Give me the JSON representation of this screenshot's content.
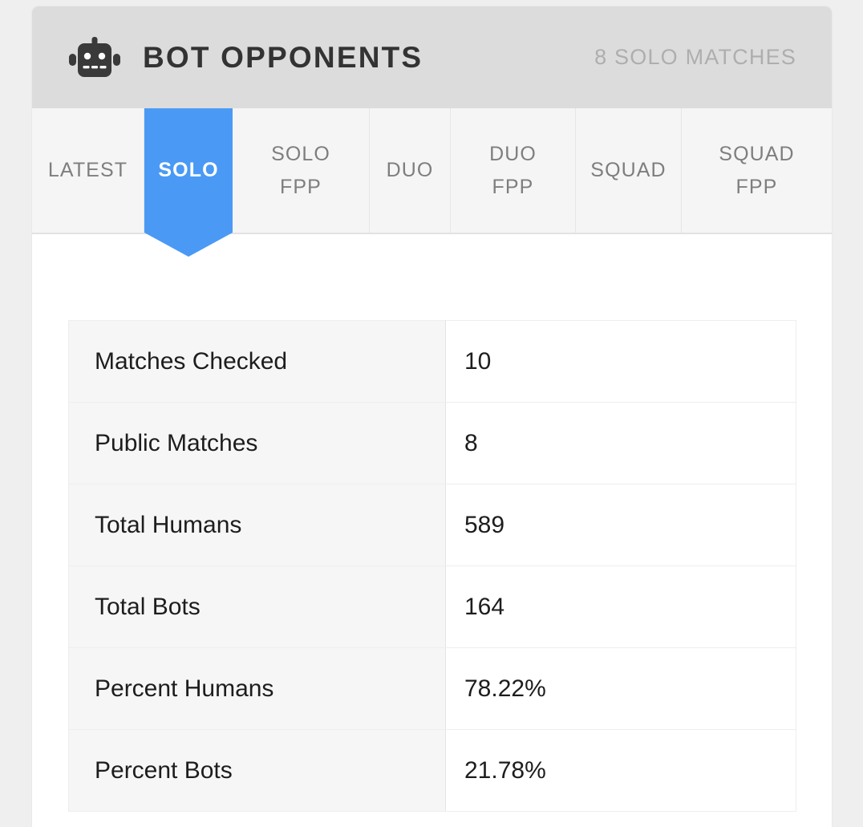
{
  "header": {
    "icon": "robot-icon",
    "title": "BOT OPPONENTS",
    "subtitle": "8 SOLO MATCHES"
  },
  "tabs": [
    {
      "label": "LATEST",
      "line1": "LATEST",
      "line2": "",
      "active": false
    },
    {
      "label": "SOLO",
      "line1": "SOLO",
      "line2": "",
      "active": true
    },
    {
      "label": "SOLO FPP",
      "line1": "SOLO",
      "line2": "FPP",
      "active": false
    },
    {
      "label": "DUO",
      "line1": "DUO",
      "line2": "",
      "active": false
    },
    {
      "label": "DUO FPP",
      "line1": "DUO",
      "line2": "FPP",
      "active": false
    },
    {
      "label": "SQUAD",
      "line1": "SQUAD",
      "line2": "",
      "active": false
    },
    {
      "label": "SQUAD FPP",
      "line1": "SQUAD",
      "line2": "FPP",
      "active": false
    }
  ],
  "stats": {
    "rows": [
      {
        "label": "Matches Checked",
        "value": "10"
      },
      {
        "label": "Public Matches",
        "value": "8"
      },
      {
        "label": "Total Humans",
        "value": "589"
      },
      {
        "label": "Total Bots",
        "value": "164"
      },
      {
        "label": "Percent Humans",
        "value": "78.22%"
      },
      {
        "label": "Percent Bots",
        "value": "21.78%"
      }
    ]
  },
  "colors": {
    "accent": "#4a9af5",
    "page_background": "#efefef",
    "header_background": "#dcdcdc",
    "tabbar_background": "#f5f5f5",
    "label_cell_background": "#f6f6f6",
    "title_text": "#333333",
    "subtitle_text": "#aeaeae",
    "tab_text": "#7e7e7e"
  }
}
